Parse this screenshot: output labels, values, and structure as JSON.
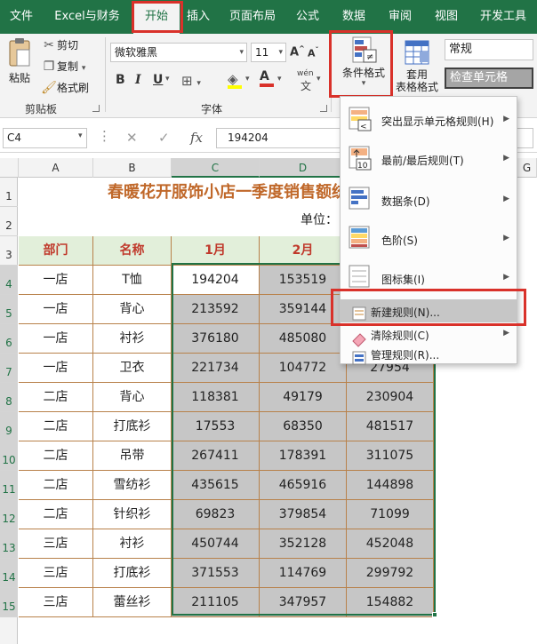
{
  "tabs": [
    "文件",
    "Excel与财务",
    "开始",
    "插入",
    "页面布局",
    "公式",
    "数据",
    "审阅",
    "视图",
    "开发工具"
  ],
  "clipboard": {
    "paste": "粘贴",
    "cut": "剪切",
    "copy": "复制",
    "format_painter": "格式刷",
    "group_label": "剪贴板"
  },
  "font": {
    "name": "微软雅黑",
    "size": "11",
    "bold": "B",
    "italic": "I",
    "underline": "U",
    "font_color": "A",
    "wen": "wén",
    "group_label": "字体"
  },
  "styles": {
    "conditional_format": "条件格式",
    "table_format_line1": "套用",
    "table_format_line2": "表格格式",
    "style_normal": "常规",
    "style_check_cell": "检查单元格"
  },
  "formula_bar": {
    "name_box": "C4",
    "cancel": "✕",
    "confirm": "✓",
    "fx": "fx",
    "value": "194204"
  },
  "columns": [
    "A",
    "B",
    "C",
    "D",
    "G"
  ],
  "rows": [
    "1",
    "2",
    "3",
    "4",
    "5",
    "6",
    "7",
    "8",
    "9",
    "10",
    "11",
    "12",
    "13",
    "14",
    "15"
  ],
  "sheet": {
    "title": "春暖花开服饰小店一季度销售额统",
    "unit_label": "单位：",
    "headers": [
      "部门",
      "名称",
      "1月",
      "2月"
    ],
    "data": [
      [
        "一店",
        "T恤",
        "194204",
        "153519",
        ""
      ],
      [
        "一店",
        "背心",
        "213592",
        "359144",
        ""
      ],
      [
        "一店",
        "衬衫",
        "376180",
        "485080",
        ""
      ],
      [
        "一店",
        "卫衣",
        "221734",
        "104772",
        "27954"
      ],
      [
        "二店",
        "背心",
        "118381",
        "49179",
        "230904"
      ],
      [
        "二店",
        "打底衫",
        "17553",
        "68350",
        "481517"
      ],
      [
        "二店",
        "吊带",
        "267411",
        "178391",
        "311075"
      ],
      [
        "二店",
        "雪纺衫",
        "435615",
        "465916",
        "144898"
      ],
      [
        "二店",
        "针织衫",
        "69823",
        "379854",
        "71099"
      ],
      [
        "三店",
        "衬衫",
        "450744",
        "352128",
        "452048"
      ],
      [
        "三店",
        "打底衫",
        "371553",
        "114769",
        "299792"
      ],
      [
        "三店",
        "蕾丝衫",
        "211105",
        "347957",
        "154882"
      ]
    ]
  },
  "menu": {
    "items": [
      "突出显示单元格规则(H)",
      "最前/最后规则(T)",
      "数据条(D)",
      "色阶(S)",
      "图标集(I)",
      "新建规则(N)...",
      "清除规则(C)",
      "管理规则(R)..."
    ],
    "icon_top_n": "10"
  },
  "colors": {
    "ribbon_green": "#217346",
    "highlight_red": "#d9312a",
    "header_fill": "#e2efda",
    "header_text": "#c0392b",
    "title_text": "#c0682a",
    "selection_grey": "#c6c6c6"
  }
}
